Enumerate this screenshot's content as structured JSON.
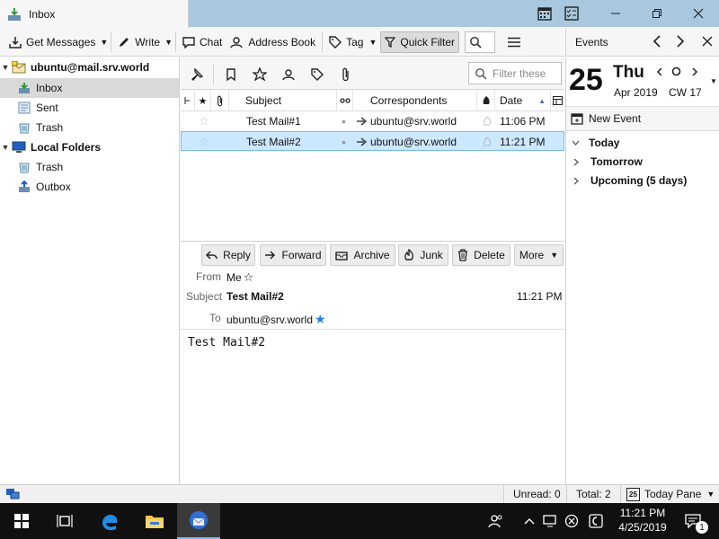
{
  "tab": {
    "title": "Inbox"
  },
  "toolbar": {
    "get_messages": "Get Messages",
    "write": "Write",
    "chat": "Chat",
    "address_book": "Address Book",
    "tag": "Tag",
    "quick_filter": "Quick Filter"
  },
  "folders": {
    "account": "ubuntu@mail.srv.world",
    "inbox": "Inbox",
    "sent": "Sent",
    "trash": "Trash",
    "local_folders": "Local Folders",
    "local_trash": "Trash",
    "outbox": "Outbox"
  },
  "filter": {
    "placeholder": "Filter these"
  },
  "columns": {
    "subject": "Subject",
    "correspondents": "Correspondents",
    "date": "Date"
  },
  "messages": [
    {
      "subject": "Test Mail#1",
      "correspondent": "ubuntu@srv.world",
      "date": "11:06 PM"
    },
    {
      "subject": "Test Mail#2",
      "correspondent": "ubuntu@srv.world",
      "date": "11:21 PM"
    }
  ],
  "message_actions": {
    "reply": "Reply",
    "forward": "Forward",
    "archive": "Archive",
    "junk": "Junk",
    "delete": "Delete",
    "more": "More"
  },
  "message_header": {
    "from_label": "From",
    "from": "Me",
    "subject_label": "Subject",
    "subject": "Test Mail#2",
    "time": "11:21 PM",
    "to_label": "To",
    "to": "ubuntu@srv.world"
  },
  "message_body": "Test Mail#2",
  "events": {
    "title": "Events",
    "day": "25",
    "weekday": "Thu",
    "month_year": "Apr 2019",
    "cw": "CW 17",
    "new_event": "New Event",
    "sections": [
      "Today",
      "Tomorrow",
      "Upcoming (5 days)"
    ]
  },
  "status": {
    "unread": "Unread: 0",
    "total": "Total: 2",
    "today_pane": "Today Pane",
    "today_icon_day": "25"
  },
  "taskbar": {
    "time": "11:21 PM",
    "date": "4/25/2019",
    "notifications": "1"
  },
  "colors": {
    "accent": "#0078d7",
    "selection": "#cce8ff",
    "selection_border": "#7ab9ee",
    "tabbar": "#a9c8df",
    "taskbar": "#101010"
  }
}
